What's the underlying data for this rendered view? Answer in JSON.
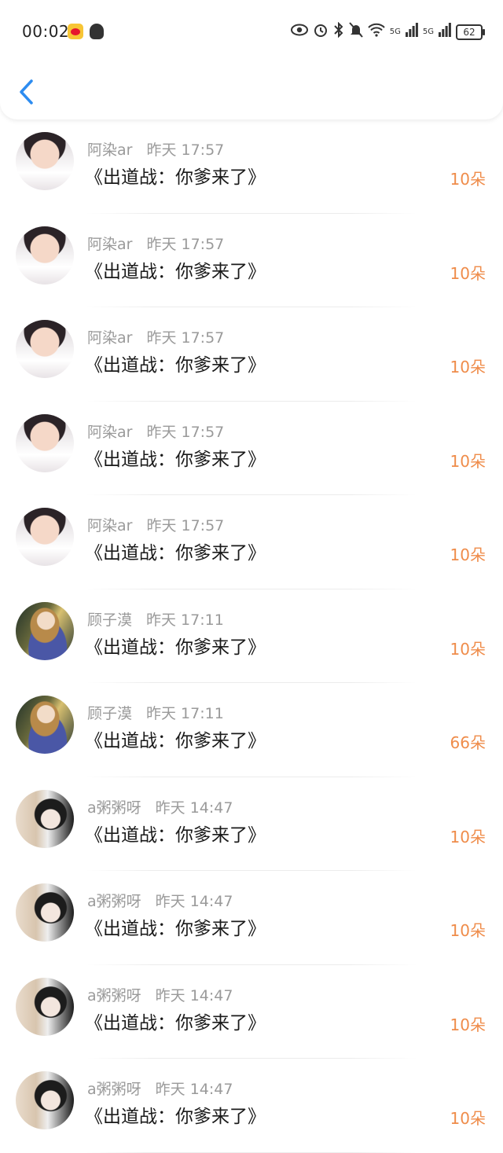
{
  "status_bar": {
    "time": "00:02",
    "signal1": "5G",
    "signal2": "5G",
    "battery": "62"
  },
  "header": {
    "back_icon": "chevron-left-icon",
    "accent_color": "#2d8cf0"
  },
  "rows": [
    {
      "name": "阿染ar",
      "time": "昨天 17:57",
      "title": "《出道战：你爹来了》",
      "count": "10朵",
      "avatar": "boy"
    },
    {
      "name": "阿染ar",
      "time": "昨天 17:57",
      "title": "《出道战：你爹来了》",
      "count": "10朵",
      "avatar": "boy"
    },
    {
      "name": "阿染ar",
      "time": "昨天 17:57",
      "title": "《出道战：你爹来了》",
      "count": "10朵",
      "avatar": "boy"
    },
    {
      "name": "阿染ar",
      "time": "昨天 17:57",
      "title": "《出道战：你爹来了》",
      "count": "10朵",
      "avatar": "boy"
    },
    {
      "name": "阿染ar",
      "time": "昨天 17:57",
      "title": "《出道战：你爹来了》",
      "count": "10朵",
      "avatar": "boy"
    },
    {
      "name": "顾子漠",
      "time": "昨天 17:11",
      "title": "《出道战：你爹来了》",
      "count": "10朵",
      "avatar": "girl1"
    },
    {
      "name": "顾子漠",
      "time": "昨天 17:11",
      "title": "《出道战：你爹来了》",
      "count": "66朵",
      "avatar": "girl1"
    },
    {
      "name": "a粥粥呀",
      "time": "昨天 14:47",
      "title": "《出道战：你爹来了》",
      "count": "10朵",
      "avatar": "girl2"
    },
    {
      "name": "a粥粥呀",
      "time": "昨天 14:47",
      "title": "《出道战：你爹来了》",
      "count": "10朵",
      "avatar": "girl2"
    },
    {
      "name": "a粥粥呀",
      "time": "昨天 14:47",
      "title": "《出道战：你爹来了》",
      "count": "10朵",
      "avatar": "girl2"
    },
    {
      "name": "a粥粥呀",
      "time": "昨天 14:47",
      "title": "《出道战：你爹来了》",
      "count": "10朵",
      "avatar": "girl2"
    }
  ],
  "colors": {
    "count": "#ef8c4a",
    "meta": "#9a9a9a",
    "title": "#1a1a1a"
  }
}
